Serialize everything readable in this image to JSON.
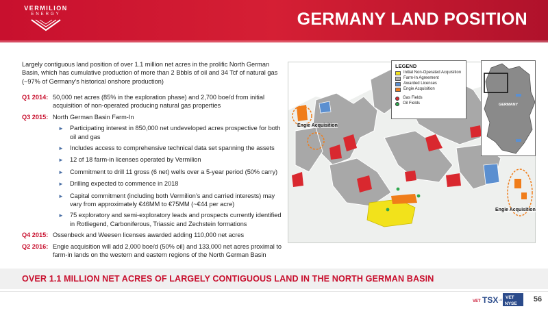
{
  "header": {
    "logo_name": "VERMILION",
    "logo_sub": "ENERGY",
    "title": "GERMANY LAND POSITION"
  },
  "intro": "Largely contiguous land position of over 1.1 million net acres in the prolific North German Basin, which has cumulative production of more than 2 Bbbls of oil and 34 Tcf of natural gas (~97% of Germany’s historical onshore production)",
  "rows": [
    {
      "label": "Q1 2014:",
      "text": "50,000 net acres (85% in the exploration phase) and 2,700 boe/d from initial acquisition of non-operated producing natural gas properties"
    },
    {
      "label": "Q3 2015:",
      "text": "North German Basin Farm-In"
    }
  ],
  "bullets": [
    "Participating interest in 850,000 net undeveloped acres prospective for both oil and gas",
    "Includes access to comprehensive technical data set spanning the assets",
    "12 of 18 farm-in licenses operated by Vermilion",
    "Commitment to drill 11 gross (6 net) wells over a 5-year period (50% carry)",
    "Drilling expected to commence in 2018",
    "Capital commitment (including both Vermilion’s and carried interests) may vary from approximately €46MM to €75MM (~€44 per acre)",
    "75 exploratory and semi-exploratory leads and prospects currently identified in Rotliegend, Carboniferous, Triassic and Zechstein formations"
  ],
  "rows_after": [
    {
      "label": "Q4 2015:",
      "text": "Ossenbeck and Weesen licenses awarded adding 110,000 net acres"
    },
    {
      "label": "Q2 2016:",
      "text": "Engie acquisition will add 2,000 boe/d (50% oil) and 133,000 net acres proximal to farm-in lands on the western and eastern regions of the North German Basin"
    }
  ],
  "legend": {
    "title": "LEGEND",
    "items": [
      {
        "label": "Initial Non-Operated Acquisition",
        "color": "#f2e21b"
      },
      {
        "label": "Farm-In Agreement",
        "color": "#a8a8a8"
      },
      {
        "label": "Awarded Licenses",
        "color": "#5b8fd0"
      },
      {
        "label": "Engie Acquisition",
        "color": "#f07d1a"
      }
    ],
    "fields": [
      {
        "label": "Gas Fields",
        "color": "#d9282f"
      },
      {
        "label": "Oil Fields",
        "color": "#2fa84f"
      }
    ]
  },
  "map": {
    "acq_west": "Engie Acquisition",
    "acq_east": "Engie Acquisition",
    "inset_country": "GERMANY"
  },
  "tagline": "OVER 1.1 MILLION NET ACRES OF LARGELY CONTIGUOUS LAND IN THE NORTH GERMAN BASIN",
  "ticker": {
    "vet": "VET",
    "tsx": "TSX",
    "vet2": "VET",
    "nyse": "NYSE",
    "listed": "LISTED"
  },
  "page_number": "56",
  "colors": {
    "brand_red": "#c8102e",
    "bullet_blue": "#4a6fa5"
  }
}
